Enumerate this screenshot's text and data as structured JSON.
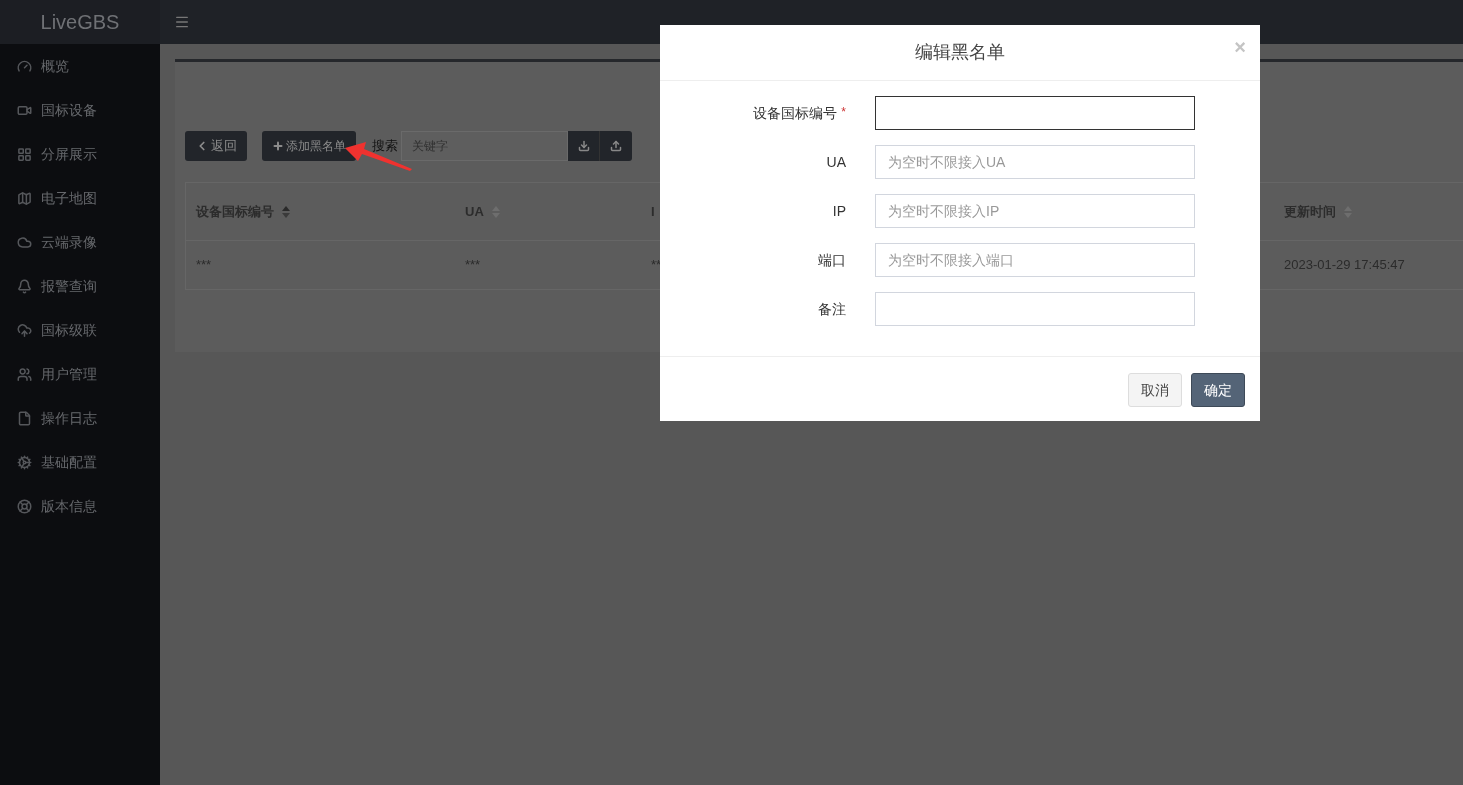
{
  "app": {
    "logo": "LiveGBS"
  },
  "sidebar": {
    "items": [
      {
        "label": "概览"
      },
      {
        "label": "国标设备"
      },
      {
        "label": "分屏展示"
      },
      {
        "label": "电子地图"
      },
      {
        "label": "云端录像"
      },
      {
        "label": "报警查询"
      },
      {
        "label": "国标级联"
      },
      {
        "label": "用户管理"
      },
      {
        "label": "操作日志"
      },
      {
        "label": "基础配置"
      },
      {
        "label": "版本信息"
      }
    ]
  },
  "toolbar": {
    "back_button": "返回",
    "add_button": "添加黑名单",
    "search_label": "搜索",
    "search_placeholder": "关键字"
  },
  "table": {
    "columns": [
      {
        "label": "设备国标编号",
        "sorted": true
      },
      {
        "label": "UA",
        "sorted": false
      },
      {
        "label": "I"
      },
      {
        "label": "更新时间",
        "sorted": false
      }
    ],
    "rows": [
      {
        "cells": [
          "***",
          "***",
          "**",
          "2023-01-29 17:45:47"
        ]
      }
    ]
  },
  "modal": {
    "title": "编辑黑名单",
    "close": "×",
    "fields": [
      {
        "label": "设备国标编号",
        "required_mark": "*",
        "focused": true
      },
      {
        "label": "UA",
        "placeholder": "为空时不限接入UA",
        "focused": false
      },
      {
        "label": "IP",
        "placeholder": "为空时不限接入IP",
        "focused": false
      },
      {
        "label": "端口",
        "placeholder": "为空时不限接入端口",
        "focused": false
      },
      {
        "label": "备注",
        "focused": false
      }
    ],
    "cancel_button": "取消",
    "confirm_button": "确定"
  }
}
